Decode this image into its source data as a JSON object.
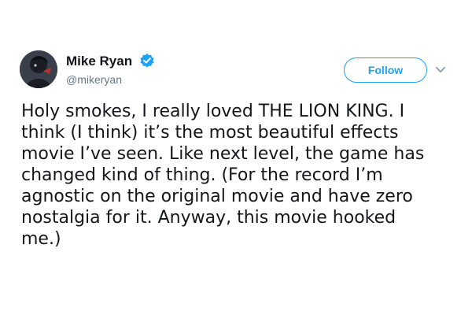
{
  "tweet": {
    "author": {
      "display_name": "Mike Ryan",
      "handle": "@mikeryan",
      "verified": true,
      "avatar_icon": "user-avatar"
    },
    "follow_label": "Follow",
    "menu_icon": "chevron-down-icon",
    "text_lines": [
      "Holy smokes, I really loved THE LION KING. I",
      "think (I think) it’s the most beautiful effects",
      "movie I’ve seen. Like next level, the game has",
      "changed kind of thing. (For the record I’m",
      "agnostic on the original movie and have zero",
      "nostalgia for it. Anyway, this movie hooked",
      "me.)"
    ]
  },
  "colors": {
    "accent": "#1da1f2",
    "text": "#14171a",
    "secondary_text": "#657786"
  }
}
